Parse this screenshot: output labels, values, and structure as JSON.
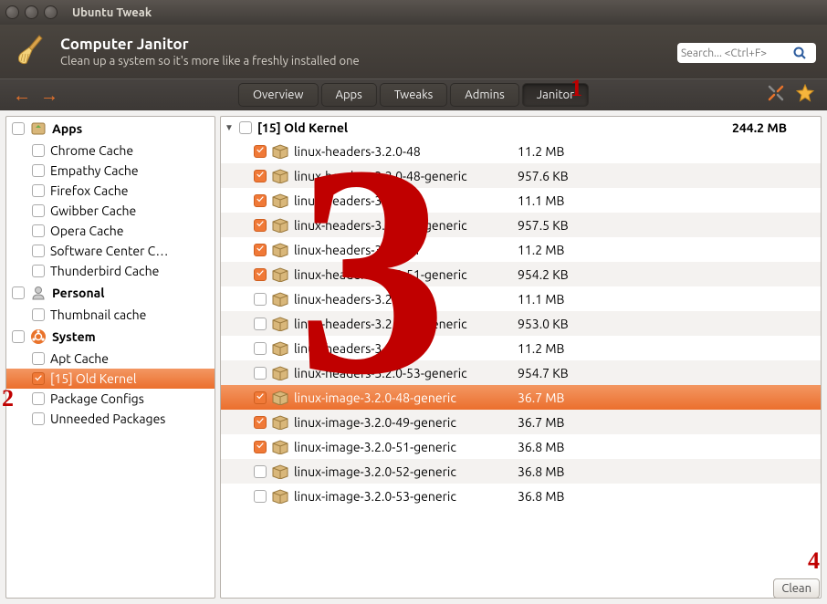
{
  "window": {
    "title": "Ubuntu Tweak"
  },
  "header": {
    "title": "Computer Janitor",
    "subtitle": "Clean up a system so it's more like a freshly installed one"
  },
  "search": {
    "placeholder": "Search... <Ctrl+F>"
  },
  "tabs": {
    "overview": "Overview",
    "apps": "Apps",
    "tweaks": "Tweaks",
    "admins": "Admins",
    "janitor": "Janitor",
    "active": "janitor"
  },
  "sidebar": {
    "apps": {
      "label": "Apps",
      "items": [
        "Chrome Cache",
        "Empathy Cache",
        "Firefox Cache",
        "Gwibber Cache",
        "Opera Cache",
        "Software Center C…",
        "Thunderbird Cache"
      ]
    },
    "personal": {
      "label": "Personal",
      "items": [
        "Thumbnail cache"
      ]
    },
    "system": {
      "label": "System",
      "items": [
        {
          "label": "Apt Cache",
          "checked": false,
          "selected": false
        },
        {
          "label": "[15] Old Kernel",
          "checked": true,
          "selected": true
        },
        {
          "label": "Package Configs",
          "checked": false,
          "selected": false
        },
        {
          "label": "Unneeded Packages",
          "checked": false,
          "selected": false
        }
      ]
    }
  },
  "main": {
    "group": {
      "label": "[15] Old Kernel",
      "size": "244.2 MB"
    },
    "rows": [
      {
        "checked": true,
        "name": "linux-headers-3.2.0-48",
        "size": "11.2 MB",
        "selected": false
      },
      {
        "checked": true,
        "name": "linux-headers-3.2.0-48-generic",
        "size": "957.6 KB",
        "selected": false
      },
      {
        "checked": true,
        "name": "linux-headers-3.2.0-49",
        "size": "11.1 MB",
        "selected": false
      },
      {
        "checked": true,
        "name": "linux-headers-3.2.0-49-generic",
        "size": "957.5 KB",
        "selected": false
      },
      {
        "checked": true,
        "name": "linux-headers-3.2.0-51",
        "size": "11.2 MB",
        "selected": false
      },
      {
        "checked": true,
        "name": "linux-headers-3.2.0-51-generic",
        "size": "954.2 KB",
        "selected": false
      },
      {
        "checked": false,
        "name": "linux-headers-3.2.0-52",
        "size": "11.1 MB",
        "selected": false
      },
      {
        "checked": false,
        "name": "linux-headers-3.2.0-52-generic",
        "size": "953.0 KB",
        "selected": false
      },
      {
        "checked": false,
        "name": "linux-headers-3.2.0-53",
        "size": "11.2 MB",
        "selected": false
      },
      {
        "checked": false,
        "name": "linux-headers-3.2.0-53-generic",
        "size": "954.7 KB",
        "selected": false
      },
      {
        "checked": true,
        "name": "linux-image-3.2.0-48-generic",
        "size": "36.7 MB",
        "selected": true
      },
      {
        "checked": true,
        "name": "linux-image-3.2.0-49-generic",
        "size": "36.7 MB",
        "selected": false
      },
      {
        "checked": true,
        "name": "linux-image-3.2.0-51-generic",
        "size": "36.8 MB",
        "selected": false
      },
      {
        "checked": false,
        "name": "linux-image-3.2.0-52-generic",
        "size": "36.8 MB",
        "selected": false
      },
      {
        "checked": false,
        "name": "linux-image-3.2.0-53-generic",
        "size": "36.8 MB",
        "selected": false
      }
    ]
  },
  "buttons": {
    "clean": "Clean"
  },
  "annotations": {
    "a1": "1",
    "a2": "2",
    "a3": "3",
    "a4": "4"
  }
}
